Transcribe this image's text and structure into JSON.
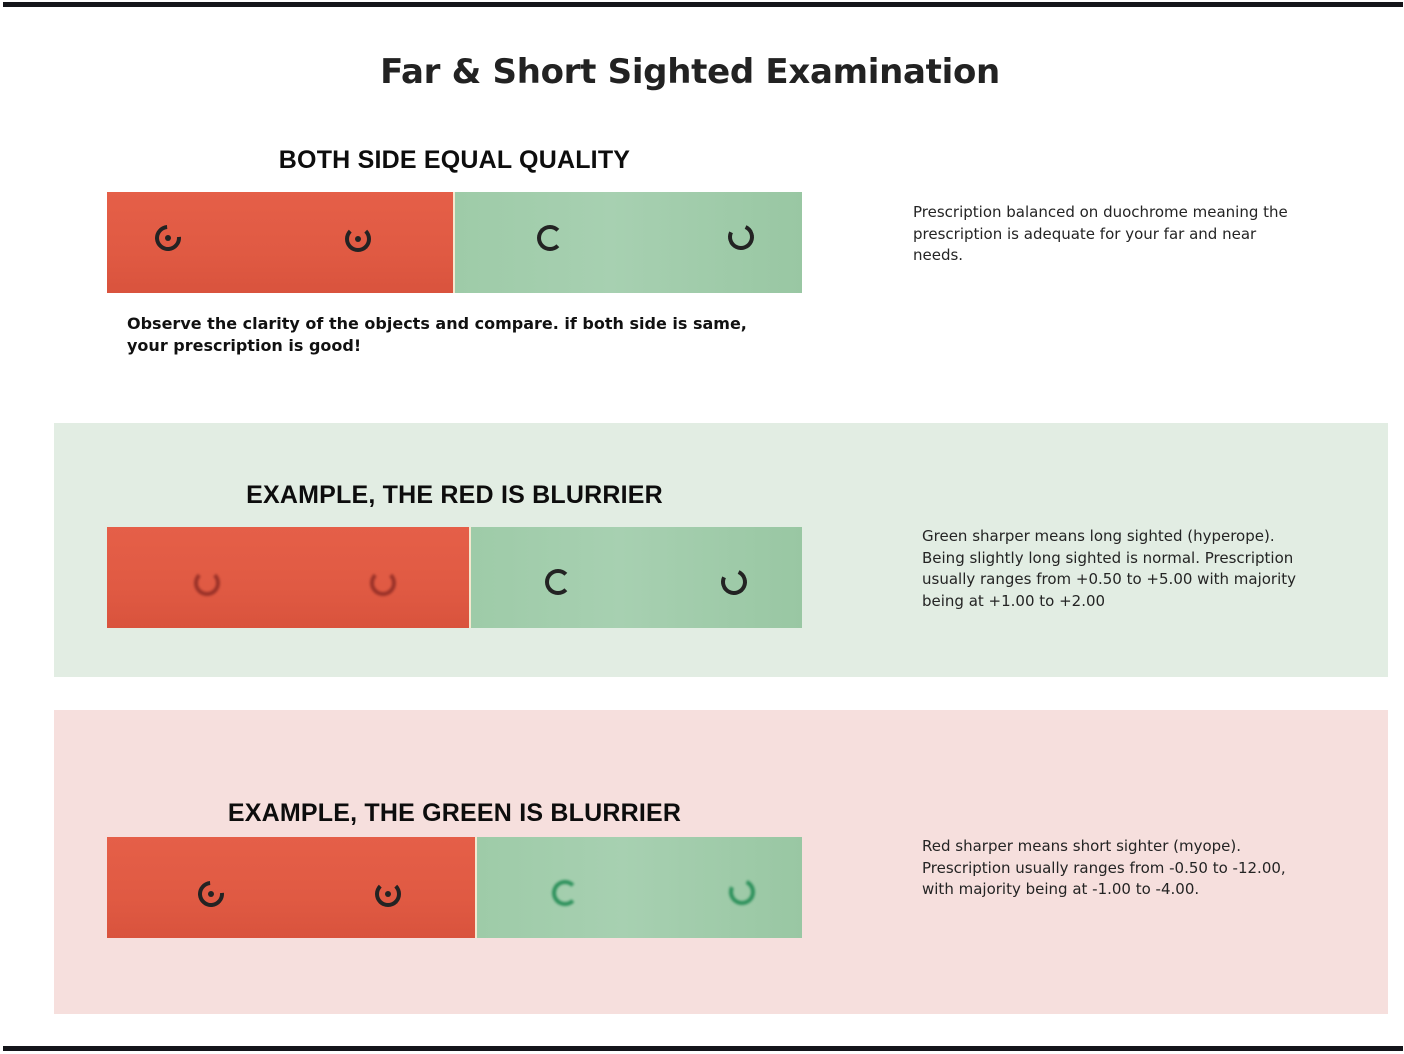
{
  "page": {
    "title": "Far & Short Sighted Examination"
  },
  "sections": [
    {
      "heading": "BOTH SIDE EQUAL QUALITY",
      "instruction": "Observe the clarity of the objects and compare. if both side is same, your prescription is good!",
      "note": "Prescription balanced on duochrome meaning the prescription is adequate for your far and near needs."
    },
    {
      "heading": "EXAMPLE, THE RED IS BLURRIER",
      "note": "Green sharper means long sighted (hyperope). Being slightly long sighted is normal. Prescription usually ranges from +0.50 to +5.00 with majority being at +1.00 to +2.00"
    },
    {
      "heading": "EXAMPLE, THE GREEN IS BLURRIER",
      "note": "Red sharper means short sighter (myope). Prescription usually ranges from -0.50 to -12.00, with majority being at -1.00 to -4.00."
    }
  ],
  "colors": {
    "red_side": "#e05a43",
    "green_side": "#a7d0b1",
    "green_panel": "#e2ede3",
    "pink_panel": "#f6dfdd"
  },
  "icons": {
    "target": "landolt-ring-icon"
  }
}
